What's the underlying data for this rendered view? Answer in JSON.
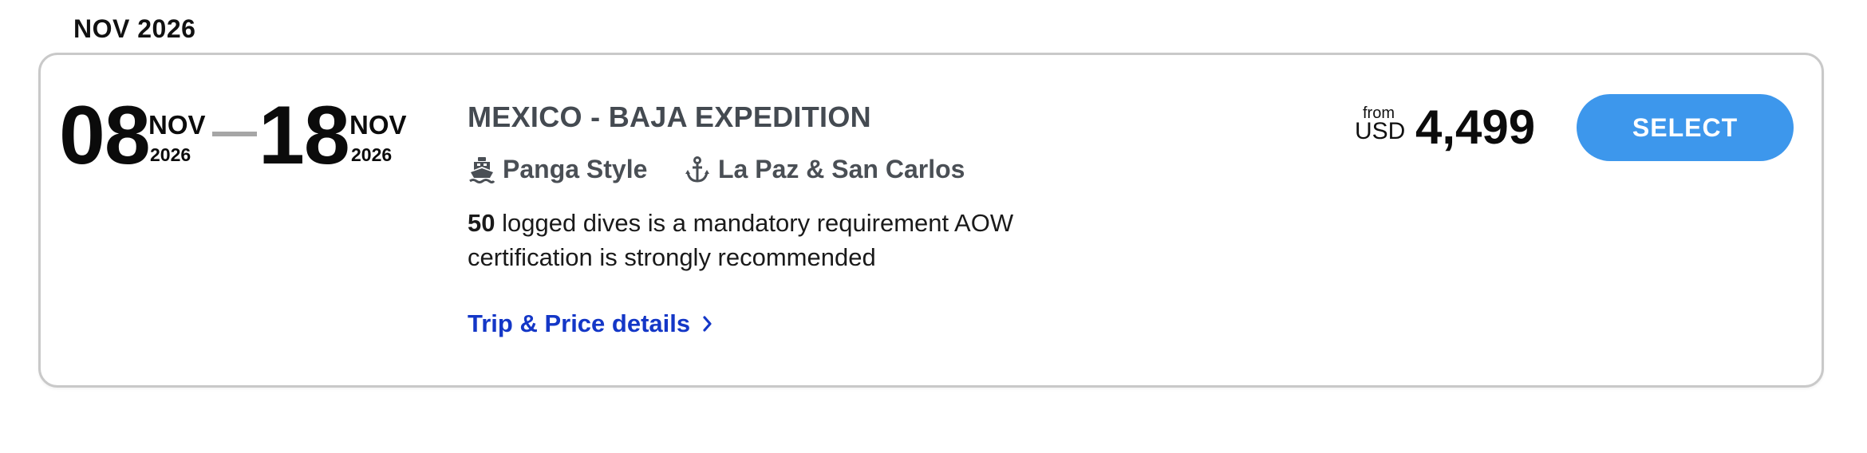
{
  "month_heading": "NOV 2026",
  "trip": {
    "start": {
      "day": "08",
      "month": "NOV",
      "year": "2026"
    },
    "end": {
      "day": "18",
      "month": "NOV",
      "year": "2026"
    },
    "title": "MEXICO - BAJA EXPEDITION",
    "style": {
      "icon": "boat-icon",
      "label": "Panga Style"
    },
    "port": {
      "icon": "anchor-icon",
      "label": "La Paz & San Carlos"
    },
    "requirement": {
      "dive_count": "50",
      "text_line1": " logged dives is a mandatory requirement AOW",
      "text_line2": "certification is strongly recommended"
    },
    "details_link": "Trip & Price details",
    "price": {
      "from_label": "from",
      "currency": "USD",
      "amount": "4,499"
    },
    "select_label": "SELECT"
  },
  "colors": {
    "select_button": "#3d97ec",
    "details_link": "#1437c7",
    "title": "#444a51",
    "card_border": "#c9c9c9"
  }
}
